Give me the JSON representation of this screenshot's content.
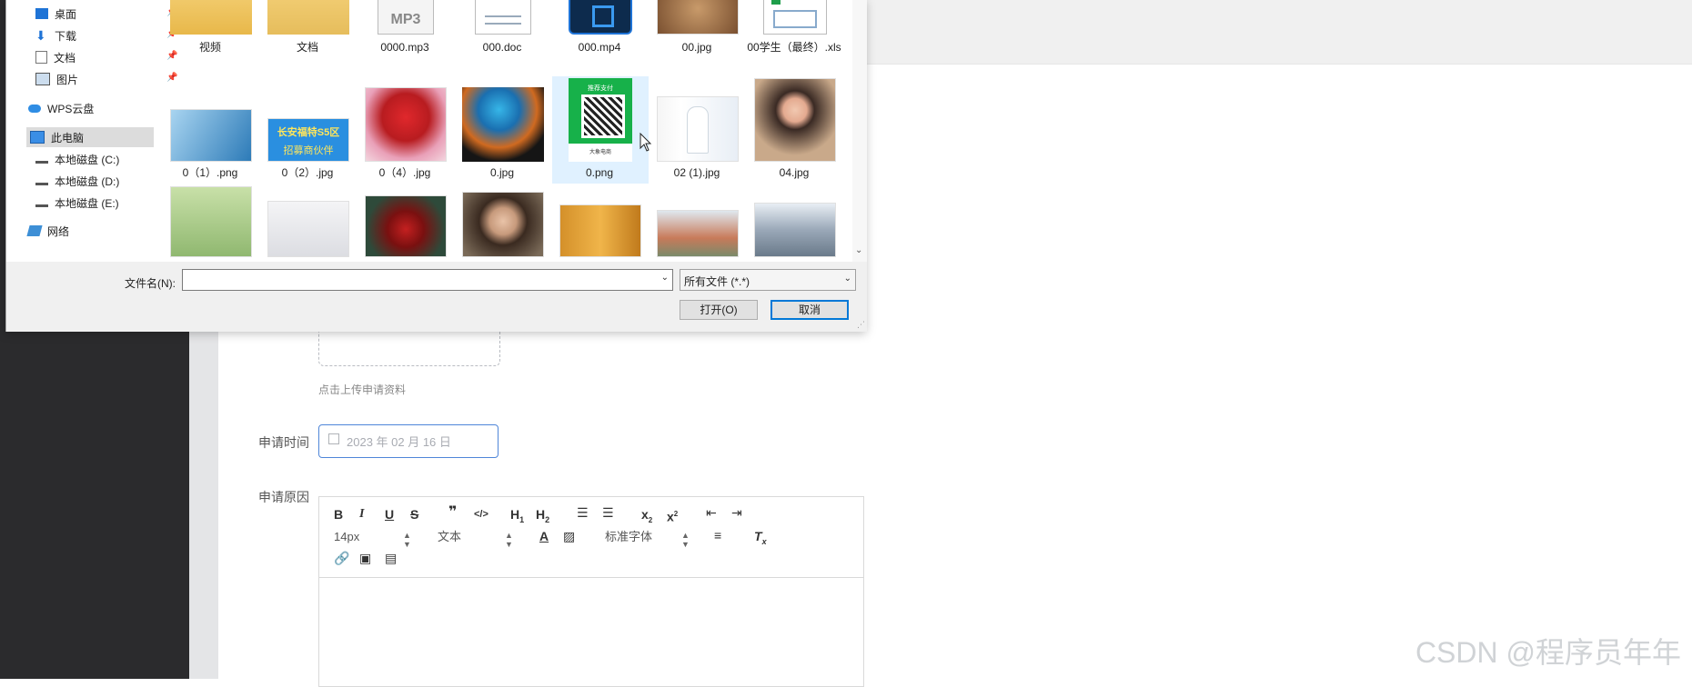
{
  "dialog": {
    "nav": {
      "items": [
        {
          "label": "桌面",
          "icon": "desktop-icon",
          "pinned": true
        },
        {
          "label": "下载",
          "icon": "download-icon",
          "pinned": true
        },
        {
          "label": "文档",
          "icon": "document-icon",
          "pinned": true
        },
        {
          "label": "图片",
          "icon": "pictures-icon",
          "pinned": true
        },
        {
          "label": "WPS云盘",
          "icon": "cloud-icon",
          "pinned": false
        },
        {
          "label": "此电脑",
          "icon": "computer-icon",
          "pinned": false,
          "selected": true
        },
        {
          "label": "本地磁盘 (C:)",
          "icon": "drive-icon",
          "pinned": false
        },
        {
          "label": "本地磁盘 (D:)",
          "icon": "drive-icon",
          "pinned": false
        },
        {
          "label": "本地磁盘 (E:)",
          "icon": "drive-icon",
          "pinned": false
        },
        {
          "label": "网络",
          "icon": "network-icon",
          "pinned": false
        }
      ]
    },
    "files_row1": [
      {
        "name": "视频",
        "type": "folder"
      },
      {
        "name": "文档",
        "type": "folder"
      },
      {
        "name": "0000.mp3",
        "type": "mp3"
      },
      {
        "name": "000.doc",
        "type": "doc"
      },
      {
        "name": "000.mp4",
        "type": "mp4"
      },
      {
        "name": "00.jpg",
        "type": "image"
      },
      {
        "name": "00学生（最终）.xls",
        "type": "xls"
      }
    ],
    "files_row2": [
      {
        "name": "0（1）.png",
        "type": "image"
      },
      {
        "name": "0（2）.jpg",
        "type": "image"
      },
      {
        "name": "0（4）.jpg",
        "type": "image"
      },
      {
        "name": "0.jpg",
        "type": "image"
      },
      {
        "name": "0.png",
        "type": "image",
        "selected": true
      },
      {
        "name": "02 (1).jpg",
        "type": "image"
      },
      {
        "name": "04.jpg",
        "type": "image"
      }
    ],
    "files_row3": [
      {
        "name": "",
        "type": "image"
      },
      {
        "name": "",
        "type": "image"
      },
      {
        "name": "",
        "type": "image"
      },
      {
        "name": "",
        "type": "image"
      },
      {
        "name": "",
        "type": "image"
      },
      {
        "name": "",
        "type": "image"
      },
      {
        "name": "",
        "type": "image"
      }
    ],
    "thumb_text": {
      "mp3_label": "MP3",
      "poster_line1": "长安福特S5区",
      "poster_line2": "招募商伙伴",
      "qr_header": "推荐支付",
      "qr_footer": "大象电商"
    },
    "filename_label": "文件名(N):",
    "filename_value": "",
    "filetype_value": "所有文件 (*.*)",
    "open_button": "打开(O)",
    "cancel_button": "取消"
  },
  "form": {
    "upload_hint": "点击上传申请资料",
    "date_label": "申请时间",
    "date_placeholder": "2023 年 02 月 16 日",
    "reason_label": "申请原因",
    "editor": {
      "font_size": "14px",
      "paragraph": "文本",
      "font_family": "标准字体"
    }
  },
  "watermark": "CSDN @程序员年年",
  "colors": {
    "accent": "#0078d7",
    "selection": "#cce8ff",
    "sidebar_dark": "#2b2b2d"
  }
}
